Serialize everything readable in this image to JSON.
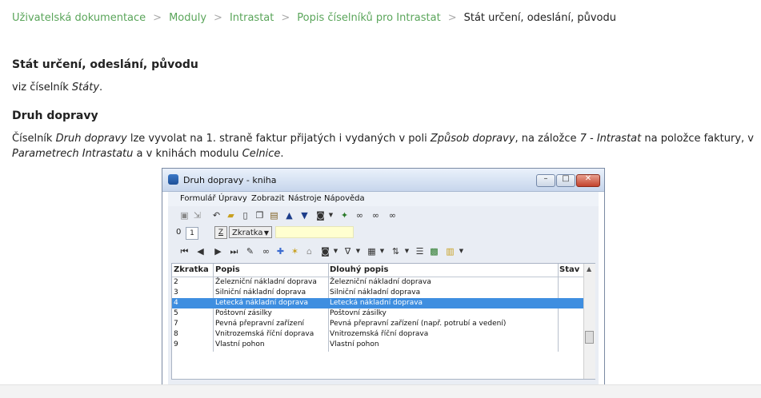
{
  "breadcrumb": {
    "items": [
      "Uživatelská dokumentace",
      "Moduly",
      "Intrastat",
      "Popis číselníků pro Intrastat"
    ],
    "current": "Stát určení, odeslání, původu",
    "separator": ">"
  },
  "section1": {
    "heading": "Stát určení, odeslání, původu",
    "text_prefix": "viz číselník ",
    "text_italic": "Státy",
    "text_suffix": "."
  },
  "section2": {
    "heading": "Druh dopravy",
    "line1": {
      "t1": "Číselník ",
      "i1": "Druh dopravy",
      "t2": " lze vyvolat na 1. straně faktur přijatých i vydaných v poli ",
      "i2": "Způsob dopravy",
      "t3": ", na záložce ",
      "i3": "7 - Intrastat",
      "t4": " na položce faktury, v"
    },
    "line2": {
      "i1": "Parametrech Intrastatu",
      "t1": " a v knihách modulu ",
      "i2": "Celnice",
      "t2": "."
    }
  },
  "window": {
    "title": "Druh dopravy - kniha",
    "min": "–",
    "max": "□",
    "close": "✕",
    "menu": [
      "Formulář",
      "Úpravy",
      "Zobrazit",
      "Nástroje",
      "Nápověda"
    ],
    "tabs": [
      "0",
      "1"
    ],
    "z_button": "Z",
    "sort_select": "Zkratka",
    "columns": [
      "Zkratka",
      "Popis",
      "Dlouhý popis",
      "Stav"
    ],
    "rows": [
      {
        "code": "2",
        "desc": "Železniční nákladní doprava",
        "long": "Železniční nákladní doprava",
        "selected": false
      },
      {
        "code": "3",
        "desc": "Silniční nákladní doprava",
        "long": "Silniční nákladní doprava",
        "selected": false
      },
      {
        "code": "4",
        "desc": "Letecká nákladní doprava",
        "long": "Letecká nákladní doprava",
        "selected": true
      },
      {
        "code": "5",
        "desc": "Poštovní zásilky",
        "long": "Poštovní zásilky",
        "selected": false
      },
      {
        "code": "7",
        "desc": "Pevná přepravní zařízení",
        "long": "Pevná přepravní zařízení (např. potrubí a vedení)",
        "selected": false
      },
      {
        "code": "8",
        "desc": "Vnitrozemská říční doprava",
        "long": "Vnitrozemská říční doprava",
        "selected": false
      },
      {
        "code": "9",
        "desc": "Vlastní pohon",
        "long": "Vlastní pohon",
        "selected": false
      }
    ]
  },
  "colors": {
    "link": "#5aa55a",
    "selection": "#3e8ee0",
    "title_bar": "#c7d6ec"
  }
}
